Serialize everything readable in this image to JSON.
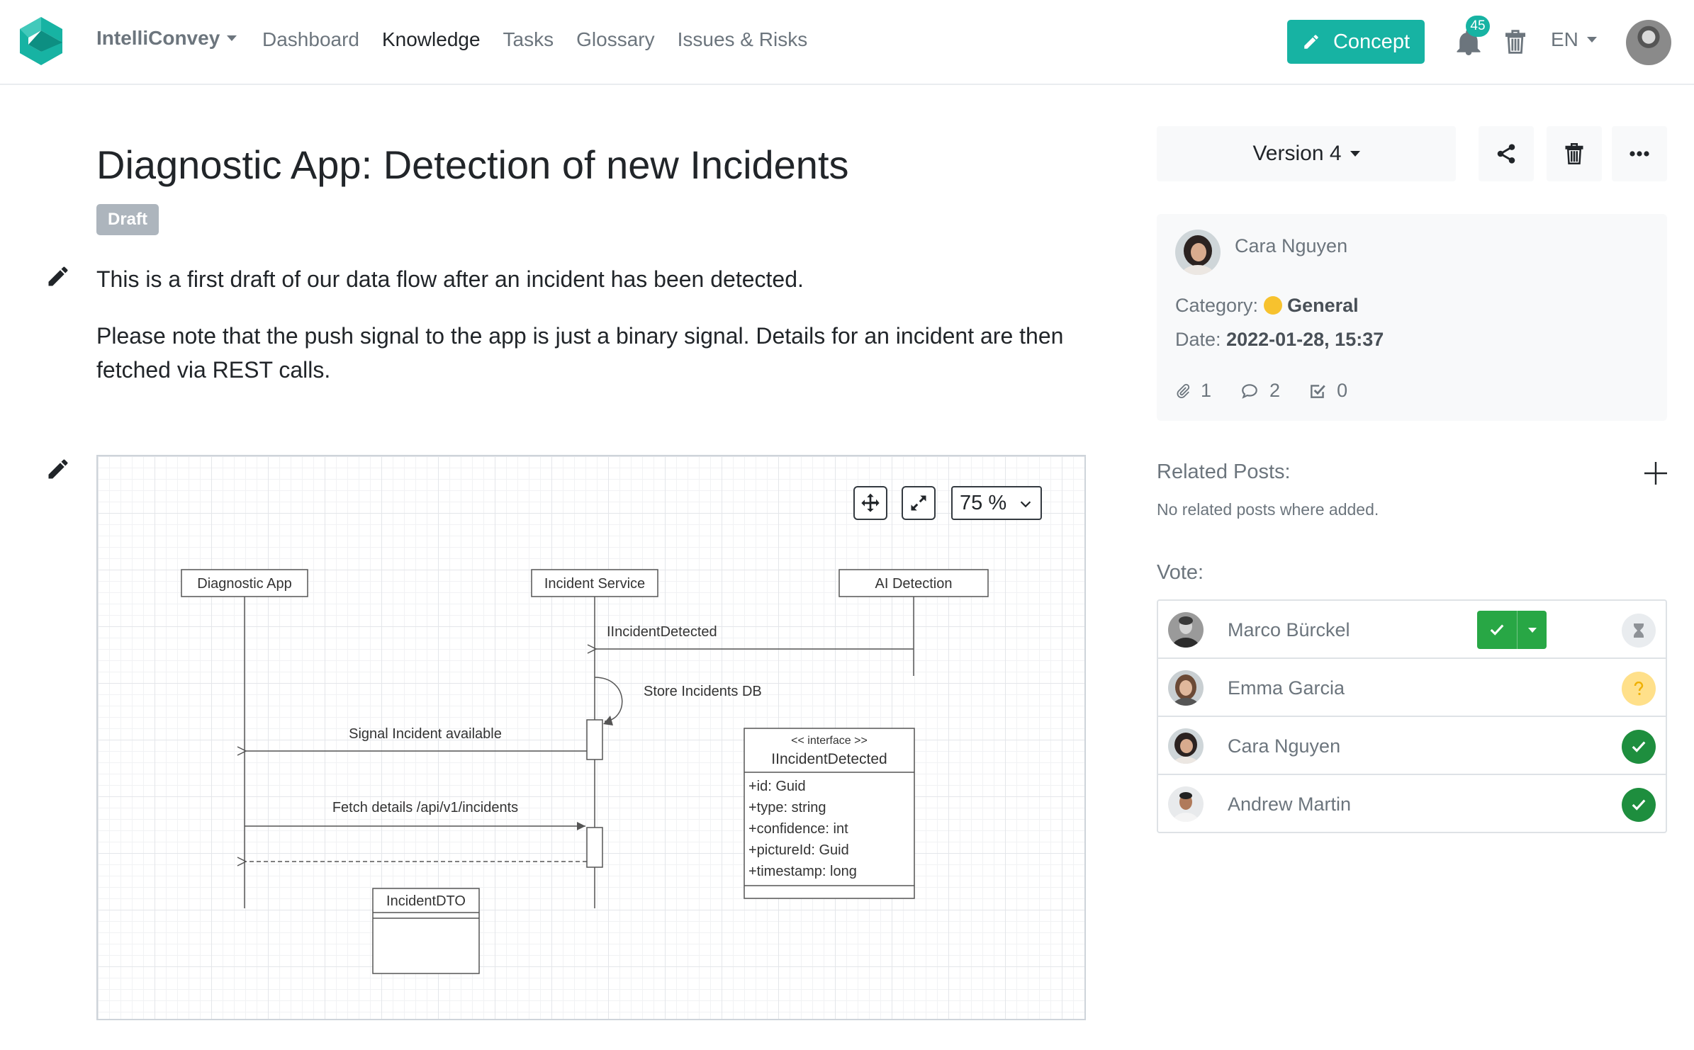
{
  "header": {
    "brand": "IntelliConvey",
    "nav": [
      "Dashboard",
      "Knowledge",
      "Tasks",
      "Glossary",
      "Issues & Risks"
    ],
    "active_nav": "Knowledge",
    "concept_label": "Concept",
    "notification_count": "45",
    "language": "EN",
    "accent_color": "#17b3a3"
  },
  "post": {
    "title": "Diagnostic App: Detection of new Incidents",
    "status": "Draft",
    "paragraph_1": "This is a first draft of our data flow after an incident has been detected.",
    "paragraph_2": "Please note that the push signal to the app is just a binary signal. Details for an incident are then fetched via REST calls."
  },
  "diagram": {
    "zoom": "75 %",
    "lifelines": [
      "Diagnostic App",
      "Incident Service",
      "AI Detection"
    ],
    "messages": {
      "m1": "IIncidentDetected",
      "m2": "Store Incidents DB",
      "m3": "Signal Incident available",
      "m4": "Fetch details /api/v1/incidents"
    },
    "interface_box": {
      "stereotype": "<< interface >>",
      "name": "IIncidentDetected",
      "fields": [
        "+id: Guid",
        "+type: string",
        "+confidence: int",
        "+pictureId: Guid",
        "+timestamp: long"
      ]
    },
    "dto_box": {
      "name": "IncidentDTO"
    }
  },
  "sidebar": {
    "version_label": "Version 4",
    "author": "Cara Nguyen",
    "category_label": "Category:",
    "category_value": "General",
    "date_label": "Date:",
    "date_value": "2022-01-28, 15:37",
    "attachments": "1",
    "comments": "2",
    "tasks": "0",
    "related_label": "Related Posts:",
    "related_empty": "No related posts where added.",
    "vote_label": "Vote:",
    "votes": [
      {
        "name": "Marco Bürckel",
        "status": "pending"
      },
      {
        "name": "Emma Garcia",
        "status": "unknown"
      },
      {
        "name": "Cara Nguyen",
        "status": "approved"
      },
      {
        "name": "Andrew Martin",
        "status": "approved"
      }
    ],
    "colors": {
      "approved": "#1e8e3e",
      "unknown": "#ffe08a",
      "pending": "#e9ecef",
      "vote_button": "#28a745"
    }
  }
}
